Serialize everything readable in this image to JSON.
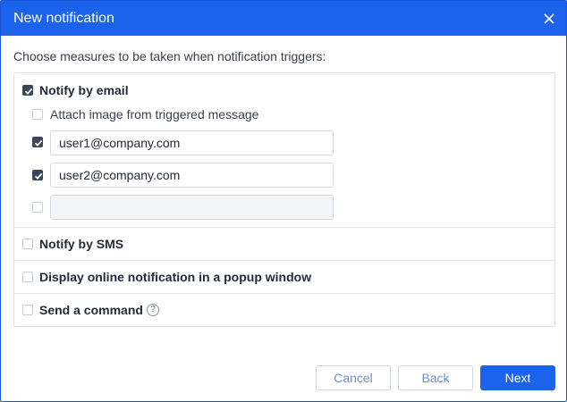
{
  "dialog": {
    "title": "New notification",
    "close_icon": "close-icon"
  },
  "instruction": "Choose measures to be taken when notification triggers:",
  "email_section": {
    "label": "Notify by email",
    "checked": true,
    "attach_image": {
      "label": "Attach image from triggered message",
      "checked": false
    },
    "recipients": [
      {
        "value": "user1@company.com",
        "checked": true
      },
      {
        "value": "user2@company.com",
        "checked": true
      },
      {
        "value": "",
        "checked": false
      }
    ]
  },
  "options": [
    {
      "label": "Notify by SMS",
      "checked": false
    },
    {
      "label": "Display online notification in a popup window",
      "checked": false
    },
    {
      "label": "Send a command",
      "checked": false,
      "help_icon": "help-icon",
      "help_symbol": "?"
    }
  ],
  "footer": {
    "cancel_label": "Cancel",
    "back_label": "Back",
    "next_label": "Next"
  },
  "colors": {
    "accent": "#1b63ea",
    "checkbox_checked": "#3c4656",
    "secondary_button_text": "#6f8fd0"
  }
}
